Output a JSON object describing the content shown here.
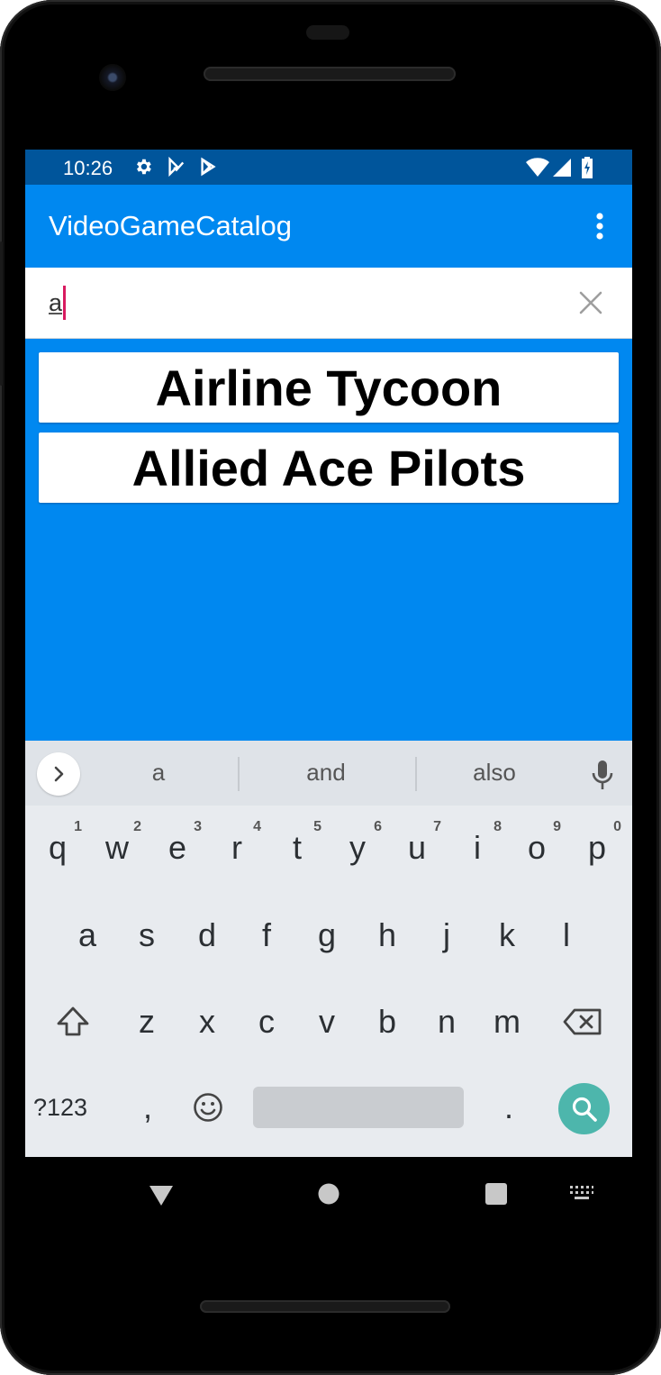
{
  "status_bar": {
    "time": "10:26",
    "left_icons": [
      "gear-icon",
      "play-store-check-icon",
      "play-store-icon"
    ],
    "right_icons": [
      "wifi-icon",
      "cell-signal-icon",
      "battery-icon"
    ]
  },
  "app_bar": {
    "title": "VideoGameCatalog",
    "menu_icon": "more-vert-icon"
  },
  "search": {
    "value": "a",
    "clear_icon": "close-icon"
  },
  "results": [
    {
      "label": "Airline Tycoon"
    },
    {
      "label": "Allied Ace Pilots"
    }
  ],
  "keyboard": {
    "suggestions": [
      "a",
      "and",
      "also"
    ],
    "row1": [
      {
        "key": "q",
        "hint": "1"
      },
      {
        "key": "w",
        "hint": "2"
      },
      {
        "key": "e",
        "hint": "3"
      },
      {
        "key": "r",
        "hint": "4"
      },
      {
        "key": "t",
        "hint": "5"
      },
      {
        "key": "y",
        "hint": "6"
      },
      {
        "key": "u",
        "hint": "7"
      },
      {
        "key": "i",
        "hint": "8"
      },
      {
        "key": "o",
        "hint": "9"
      },
      {
        "key": "p",
        "hint": "0"
      }
    ],
    "row2": [
      "a",
      "s",
      "d",
      "f",
      "g",
      "h",
      "j",
      "k",
      "l"
    ],
    "row3": [
      "z",
      "x",
      "c",
      "v",
      "b",
      "n",
      "m"
    ],
    "symbols_label": "?123",
    "comma_label": ",",
    "period_label": ".",
    "colors": {
      "background": "#e8ebef",
      "strip": "#dfe3e8",
      "search_key": "#4db6ac"
    }
  },
  "colors": {
    "status_bar": "#00559b",
    "app_bar": "#0088f0",
    "content": "#0088f0",
    "cursor": "#d81b60"
  }
}
